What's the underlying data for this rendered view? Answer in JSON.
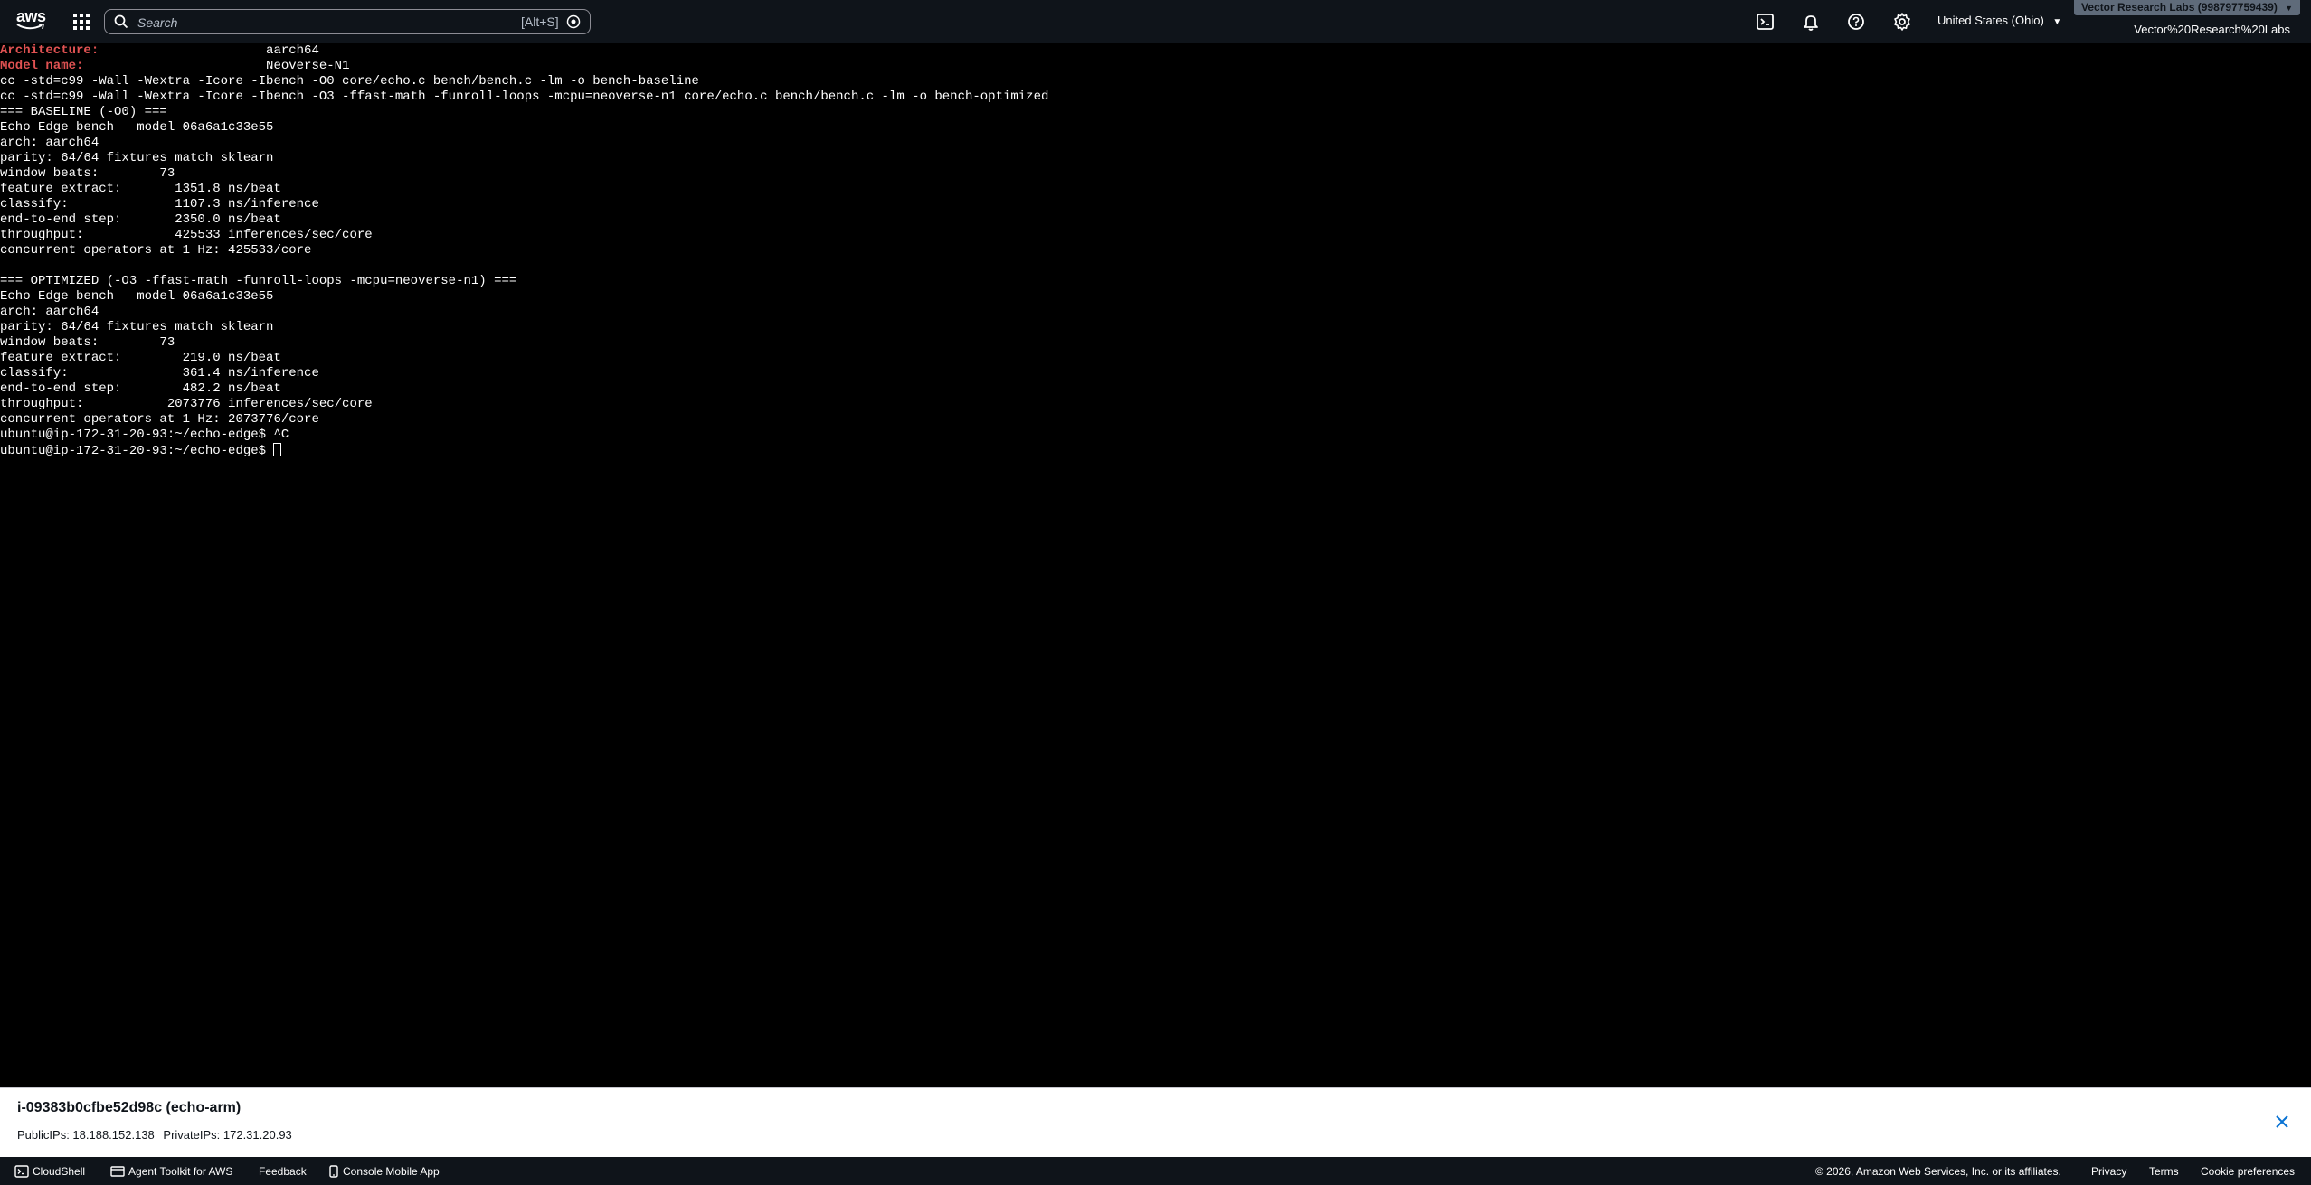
{
  "topnav": {
    "logo_text": "aws",
    "search_placeholder": "Search",
    "search_shortcut": "[Alt+S]",
    "region_label": "United States (Ohio)",
    "account_badge": "Vector Research Labs (998797759439)",
    "account_name": "Vector%20Research%20Labs"
  },
  "terminal": {
    "lines": [
      [
        {
          "t": "Architecture:",
          "c": "red"
        },
        {
          "t": "                      aarch64"
        }
      ],
      [
        {
          "t": "Model name:",
          "c": "red"
        },
        {
          "t": "                        Neoverse-N1"
        }
      ],
      [
        {
          "t": "cc -std=c99 -Wall -Wextra -Icore -Ibench -O0 core/echo.c bench/bench.c -lm -o bench-baseline"
        }
      ],
      [
        {
          "t": "cc -std=c99 -Wall -Wextra -Icore -Ibench -O3 -ffast-math -funroll-loops -mcpu=neoverse-n1 core/echo.c bench/bench.c -lm -o bench-optimized"
        }
      ],
      [
        {
          "t": "=== BASELINE (-O0) ==="
        }
      ],
      [
        {
          "t": "Echo Edge bench — model 06a6a1c33e55"
        }
      ],
      [
        {
          "t": "arch: aarch64"
        }
      ],
      [
        {
          "t": "parity: 64/64 fixtures match sklearn"
        }
      ],
      [
        {
          "t": "window beats:        73"
        }
      ],
      [
        {
          "t": "feature extract:       1351.8 ns/beat"
        }
      ],
      [
        {
          "t": "classify:              1107.3 ns/inference"
        }
      ],
      [
        {
          "t": "end-to-end step:       2350.0 ns/beat"
        }
      ],
      [
        {
          "t": "throughput:            425533 inferences/sec/core"
        }
      ],
      [
        {
          "t": "concurrent operators at 1 Hz: 425533/core"
        }
      ],
      [
        {
          "t": ""
        }
      ],
      [
        {
          "t": "=== OPTIMIZED (-O3 -ffast-math -funroll-loops -mcpu=neoverse-n1) ==="
        }
      ],
      [
        {
          "t": "Echo Edge bench — model 06a6a1c33e55"
        }
      ],
      [
        {
          "t": "arch: aarch64"
        }
      ],
      [
        {
          "t": "parity: 64/64 fixtures match sklearn"
        }
      ],
      [
        {
          "t": "window beats:        73"
        }
      ],
      [
        {
          "t": "feature extract:        219.0 ns/beat"
        }
      ],
      [
        {
          "t": "classify:               361.4 ns/inference"
        }
      ],
      [
        {
          "t": "end-to-end step:        482.2 ns/beat"
        }
      ],
      [
        {
          "t": "throughput:           2073776 inferences/sec/core"
        }
      ],
      [
        {
          "t": "concurrent operators at 1 Hz: 2073776/core"
        }
      ],
      [
        {
          "t": "ubuntu@ip-172-31-20-93:~/echo-edge$ ^C"
        }
      ],
      [
        {
          "t": "ubuntu@ip-172-31-20-93:~/echo-edge$ "
        }
      ]
    ]
  },
  "instance": {
    "title": "i-09383b0cfbe52d98c (echo-arm)",
    "public_ips": "PublicIPs: 18.188.152.138",
    "private_ips": "PrivateIPs: 172.31.20.93"
  },
  "footer": {
    "cloudshell": "CloudShell",
    "agent_toolkit": "Agent Toolkit for AWS",
    "feedback": "Feedback",
    "console_mobile": "Console Mobile App",
    "copyright": "© 2026, Amazon Web Services, Inc. or its affiliates.",
    "privacy": "Privacy",
    "terms": "Terms",
    "cookie_prefs": "Cookie preferences"
  },
  "colors": {
    "nav_bg": "#0f141a",
    "terminal_bg": "#000000",
    "terminal_fg": "#ffffff",
    "terminal_label_red": "#e05252"
  }
}
